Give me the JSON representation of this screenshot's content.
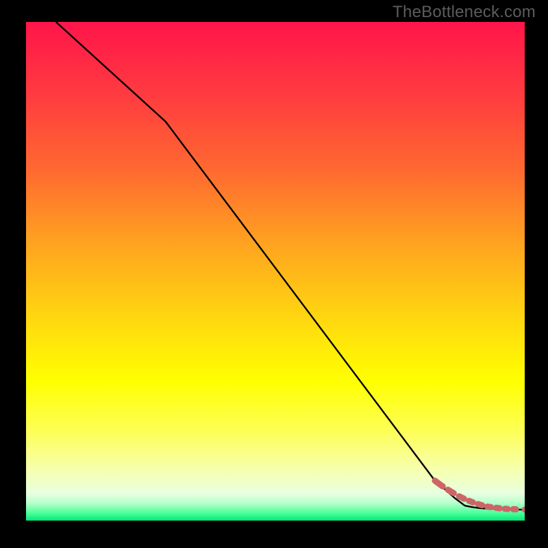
{
  "watermark": "TheBottleneck.com",
  "colors": {
    "background": "#000000",
    "line": "#000000",
    "marker": "#cc6666",
    "watermark": "#5c5c5c",
    "gradient_stops": [
      {
        "offset": 0.0,
        "color": "#ff154a"
      },
      {
        "offset": 0.15,
        "color": "#ff3c3f"
      },
      {
        "offset": 0.3,
        "color": "#ff6a30"
      },
      {
        "offset": 0.45,
        "color": "#ffa51f"
      },
      {
        "offset": 0.6,
        "color": "#ffd90f"
      },
      {
        "offset": 0.72,
        "color": "#ffff00"
      },
      {
        "offset": 0.82,
        "color": "#fdff55"
      },
      {
        "offset": 0.9,
        "color": "#f6ffb0"
      },
      {
        "offset": 0.945,
        "color": "#e9ffe0"
      },
      {
        "offset": 0.965,
        "color": "#b5ffcc"
      },
      {
        "offset": 0.985,
        "color": "#4cff99"
      },
      {
        "offset": 1.0,
        "color": "#00e67a"
      }
    ]
  },
  "chart_data": {
    "type": "line",
    "title": "",
    "xlabel": "",
    "ylabel": "",
    "xlim": [
      0,
      100
    ],
    "ylim": [
      0,
      100
    ],
    "series": [
      {
        "name": "curve",
        "x": [
          6,
          28,
          82,
          86,
          88,
          89.5,
          91,
          92.5,
          94,
          95.5,
          97,
          98.5,
          100
        ],
        "y": [
          100,
          80,
          8,
          4.5,
          3,
          2.7,
          2.5,
          2.4,
          2.4,
          2.3,
          2.3,
          2.2,
          2.2
        ]
      }
    ],
    "markers": {
      "name": "highlight-points",
      "x": [
        82,
        83.2,
        84.4,
        85.6,
        86.8,
        88.0,
        89.5,
        91.0,
        92.5,
        94.0,
        95.5,
        97.0,
        98.5,
        100.0
      ],
      "y": [
        8.0,
        7.1,
        6.3,
        5.6,
        4.9,
        4.3,
        3.7,
        3.2,
        2.8,
        2.6,
        2.4,
        2.3,
        2.25,
        2.2
      ]
    }
  }
}
